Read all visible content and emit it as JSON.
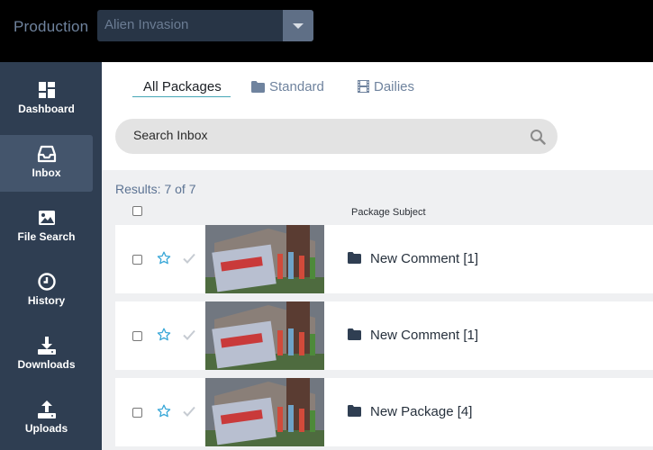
{
  "header": {
    "production_label": "Production",
    "production_select": {
      "selected": "Alien Invasion"
    }
  },
  "sidebar": {
    "items": [
      {
        "label": "Dashboard",
        "icon": "dashboard-icon",
        "active": false
      },
      {
        "label": "Inbox",
        "icon": "inbox-icon",
        "active": true
      },
      {
        "label": "File Search",
        "icon": "image-icon",
        "active": false
      },
      {
        "label": "History",
        "icon": "clock-icon",
        "active": false
      },
      {
        "label": "Downloads",
        "icon": "download-icon",
        "active": false
      },
      {
        "label": "Uploads",
        "icon": "upload-icon",
        "active": false
      }
    ]
  },
  "tabs": [
    {
      "label": "All Packages",
      "active": true
    },
    {
      "label": "Standard",
      "icon": "folder-icon"
    },
    {
      "label": "Dailies",
      "icon": "film-icon"
    }
  ],
  "search": {
    "placeholder": "Search Inbox"
  },
  "results": {
    "text": "Results: 7 of 7"
  },
  "table": {
    "header_subject": "Package Subject",
    "rows": [
      {
        "subject": "New Comment [1]",
        "starred": false
      },
      {
        "subject": "New Comment [1]",
        "starred": false
      },
      {
        "subject": "New Package [4]",
        "starred": false
      }
    ]
  },
  "colors": {
    "topbar": "#000000",
    "sidebar": "#2f3e52",
    "sidebar_active": "#44556c",
    "accent": "#46a6b6",
    "star": "#3aa8d8"
  }
}
